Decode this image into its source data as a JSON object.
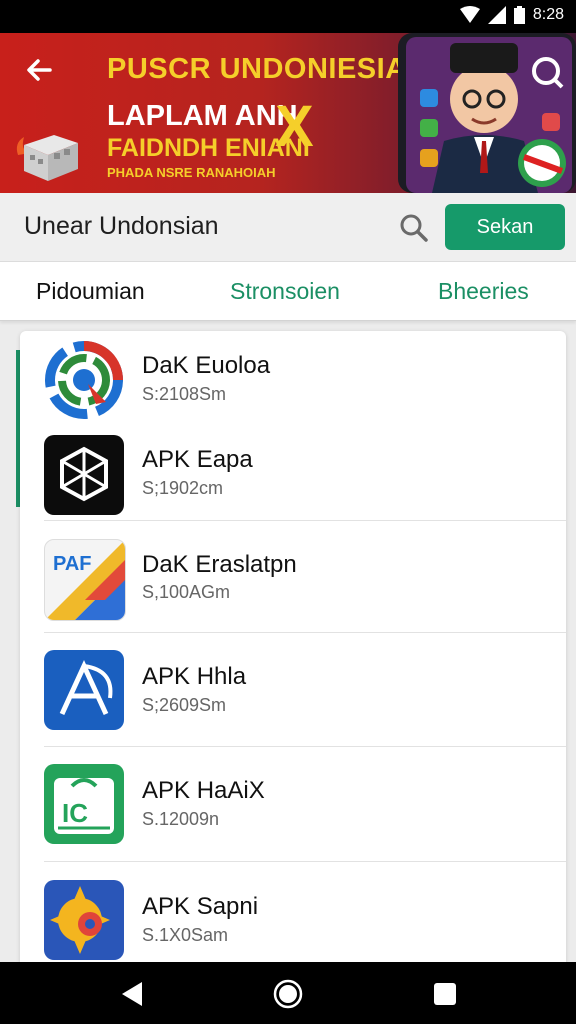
{
  "status": {
    "time": "8:28"
  },
  "banner": {
    "headline": "PUSCR UNDONIESIA",
    "line1": "LAPLAM ANH",
    "line2": "FAIDNDH ENIANI",
    "line3": "PHADA NSRE RANAHOIAH",
    "x_mark": "X"
  },
  "search": {
    "value": "Unear Undonsian",
    "button_label": "Sekan"
  },
  "tabs": [
    "Pidoumian",
    "Stronsoien",
    "Bheeries"
  ],
  "apps": [
    {
      "name": "DaK Euoloa",
      "size": "S:2108Sm"
    },
    {
      "name": "APK Eapa",
      "size": "S;1902cm"
    },
    {
      "name": "DaK Eraslatpn",
      "size": "S,100AGm"
    },
    {
      "name": "APK Hhla",
      "size": "S;2609Sm"
    },
    {
      "name": "APK HaAiX",
      "size": "S.12009n"
    },
    {
      "name": "APK Sapni",
      "size": "S.1X0Sam"
    }
  ],
  "colors": {
    "accent": "#169a6a",
    "banner_red": "#c8201b",
    "banner_yellow": "#f5cf2a"
  }
}
